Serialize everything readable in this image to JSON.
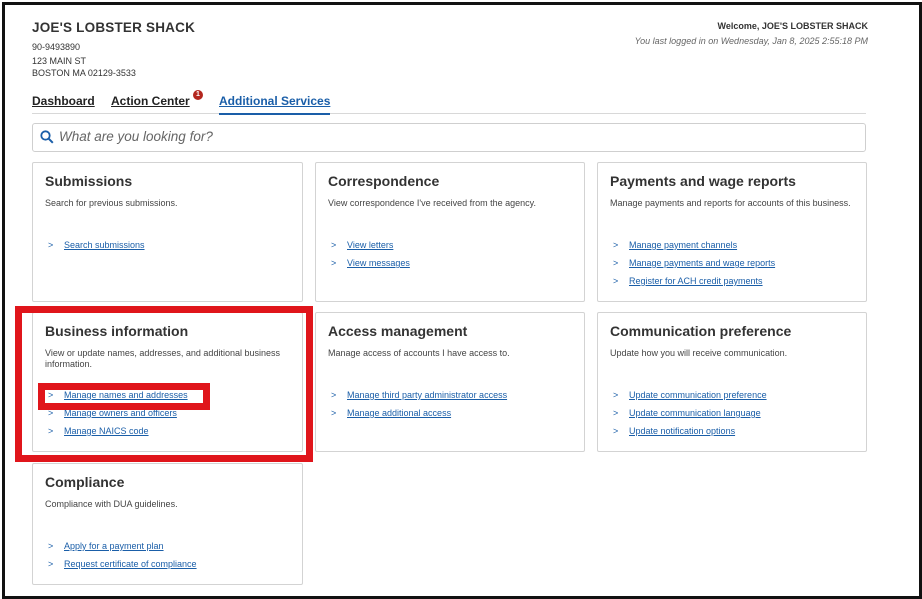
{
  "header": {
    "business_name": "JOE'S LOBSTER SHACK",
    "account_id": "90-9493890",
    "address_line1": "123 MAIN ST",
    "address_line2": "BOSTON MA 02129-3533",
    "welcome": "Welcome, JOE'S LOBSTER SHACK",
    "last_login": "You last logged in on Wednesday, Jan 8, 2025 2:55:18 PM"
  },
  "tabs": {
    "dashboard": "Dashboard",
    "action_center": "Action Center",
    "action_center_badge": "1",
    "additional_services": "Additional Services"
  },
  "search": {
    "placeholder": "What are you looking for?"
  },
  "cards": {
    "submissions": {
      "title": "Submissions",
      "description": "Search for previous submissions.",
      "links": [
        "Search submissions"
      ]
    },
    "correspondence": {
      "title": "Correspondence",
      "description": "View correspondence I've received from the agency.",
      "links": [
        "View letters",
        "View messages"
      ]
    },
    "payments": {
      "title": "Payments and wage reports",
      "description": "Manage payments and reports for accounts of this business.",
      "links": [
        "Manage payment channels",
        "Manage payments and wage reports",
        "Register for ACH credit payments"
      ]
    },
    "business_info": {
      "title": "Business information",
      "description": "View or update names, addresses, and additional business information.",
      "links": [
        "Manage names and addresses",
        "Manage owners and officers",
        "Manage NAICS code"
      ]
    },
    "access": {
      "title": "Access management",
      "description": "Manage access of accounts I have access to.",
      "links": [
        "Manage third party administrator access",
        "Manage additional access"
      ]
    },
    "communication": {
      "title": "Communication preference",
      "description": "Update how you will receive communication.",
      "links": [
        "Update communication preference",
        "Update communication language",
        "Update notification options"
      ]
    },
    "compliance": {
      "title": "Compliance",
      "description": "Compliance with DUA guidelines.",
      "links": [
        "Apply for a payment plan",
        "Request certificate of compliance"
      ]
    }
  },
  "colors": {
    "link": "#1a5ea8",
    "highlight": "#e0151b",
    "badge": "#b3261e"
  },
  "icons": {
    "search": "search-icon",
    "chevron": "chevron-right-icon"
  }
}
